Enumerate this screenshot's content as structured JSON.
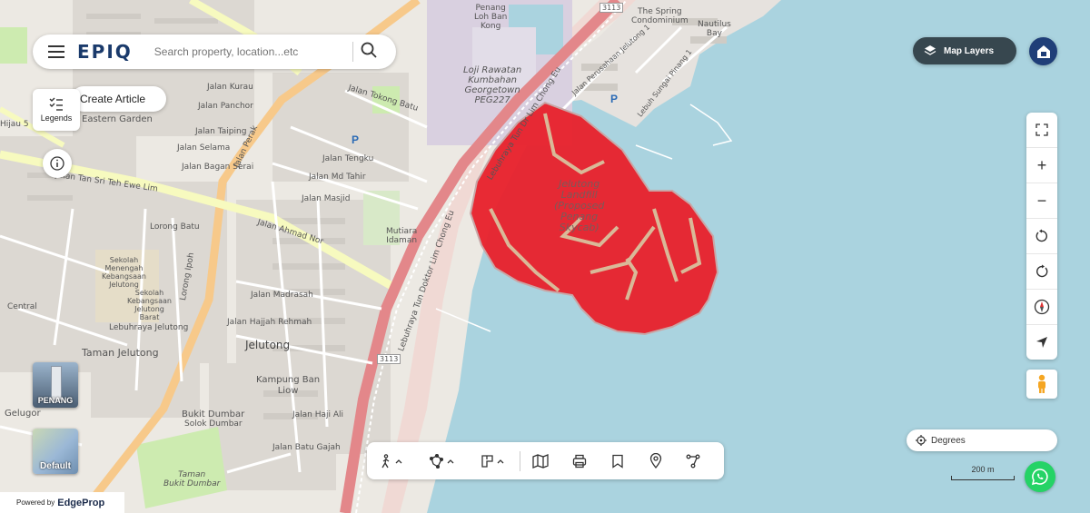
{
  "app": {
    "logo": "EPIQ"
  },
  "search": {
    "placeholder": "Search property, location...etc"
  },
  "left_panel": {
    "create_article": "Create Article",
    "legends": "Legends"
  },
  "layers": [
    {
      "label": "PENANG"
    },
    {
      "label": "Default"
    }
  ],
  "powered_by": {
    "prefix": "Powered by",
    "brand": "EdgeProp"
  },
  "right_panel": {
    "map_layers": "Map Layers",
    "degrees": "Degrees",
    "scale": "200 m"
  },
  "map": {
    "highlight": {
      "name": "Jelutong Landfill (Proposed Penang Skycab)",
      "lines": [
        "Jelutong",
        "Landfill",
        "(Proposed",
        "Penang",
        "Skycab)"
      ],
      "color": "#e8202a"
    },
    "labels": {
      "penang_loh_ban_kong": [
        "Penang",
        "Loh Ban",
        "Kong"
      ],
      "loji": [
        "Loji Rawatan",
        "Kumbahan",
        "Georgetown",
        "PEG227"
      ],
      "spring": [
        "The Spring",
        "Condominium"
      ],
      "nautilus": [
        "Nautilus",
        "Bay"
      ],
      "lebuhraya_1": "Lebuhraya Tun Dr Lim Chong Eu",
      "lebuhraya_2": "Lebuhraya Tun Doktor Lim Chong Eu",
      "jalan_ahmad_nor": "Jalan Ahmad Nor",
      "jalan_perak": "Jalan Perak",
      "jelutong": "Jelutong",
      "taman_jelutong": "Taman Jelutong",
      "kampung_ban_liow": [
        "Kampung Ban",
        "Liow"
      ],
      "bukit_dumbar": "Bukit Dumbar",
      "solok_dumbar": "Solok Dumbar",
      "eastern_garden": "Eastern Garden",
      "jalan_md_tahir": "Jalan Md Tahir",
      "jalan_masjid": "Jalan Masjid",
      "jalan_tengku": "Jalan Tengku",
      "jalan_madrasah": "Jalan Madrasah",
      "jalan_hajjah_rehmah": "Jalan Hajjah Rehmah",
      "jalan_haji_ali": "Jalan Haji Ali",
      "jalan_batu_gajah": "Jalan Batu Gajah",
      "mutiara_idaman": [
        "Mutiara",
        "Idaman"
      ],
      "sekolah_1": [
        "Sekolah",
        "Menengah",
        "Kebangsaan",
        "Jelutong"
      ],
      "sekolah_2": [
        "Sekolah",
        "Kebangsaan",
        "Jelutong",
        "Barat"
      ],
      "taman_bukit_dumbar": [
        "Taman",
        "Bukit Dumbar"
      ],
      "jalan_tokong_batu": "Jalan Tokong Batu",
      "jalan_bagan_serai": "Jalan Bagan Serai",
      "jalan_selama": "Jalan Selama",
      "jalan_taiping": "Jalan Taiping",
      "jalan_panchor": "Jalan Panchor",
      "jalan_kurau": "Jalan Kurau",
      "jalan_tan_sri": "Jalan Tan Sri Teh Ewe Lim",
      "lorong_batu": "Lorong Batu",
      "lorong_ipoh": "Lorong Ipoh",
      "lebuhraya_jelutong": "Lebuhraya Jelutong",
      "lorong_perusahaan": "Jalan Perusahaan Jelutong 1",
      "lebuh_sungai_pinang": "Lebuh Sungai Pinang 1",
      "gelugor": "Gelugor",
      "hijau": "Hijau 5",
      "central": "Central",
      "lorong_seri_jelutong": "Lorong Jelutong",
      "route_3113_a": "3113",
      "route_3113_b": "3113"
    }
  }
}
